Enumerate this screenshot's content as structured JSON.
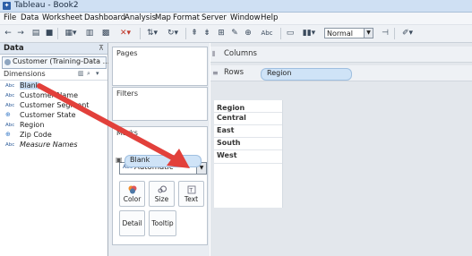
{
  "window": {
    "title": "Tableau - Book2"
  },
  "menu": [
    "File",
    "Data",
    "Worksheet",
    "Dashboard",
    "Analysis",
    "Map",
    "Format",
    "Server",
    "Window",
    "Help"
  ],
  "toolbar": {
    "fit_value": "Normal"
  },
  "data_panel": {
    "title": "Data",
    "datasource": "Customer (Training-Data ....",
    "dimensions_label": "Dimensions",
    "fields": [
      {
        "type": "Abc",
        "name": "Blank"
      },
      {
        "type": "Abc",
        "name": "Customer Name"
      },
      {
        "type": "Abc",
        "name": "Customer Segment"
      },
      {
        "type": "globe",
        "name": "Customer State"
      },
      {
        "type": "Abc",
        "name": "Region"
      },
      {
        "type": "globe",
        "name": "Zip Code"
      },
      {
        "type": "Abc",
        "name": "Measure Names"
      }
    ]
  },
  "shelves": {
    "pages_label": "Pages",
    "filters_label": "Filters",
    "marks_label": "Marks",
    "mark_type": "Automatic",
    "mark_type_icon": "Abc",
    "buttons": {
      "color": "Color",
      "size": "Size",
      "text": "Text",
      "detail": "Detail",
      "tooltip": "Tooltip"
    },
    "text_pill": "Blank"
  },
  "view": {
    "columns_label": "Columns",
    "rows_label": "Rows",
    "rows_pill": "Region",
    "table_header": "Region",
    "regions": [
      "Central",
      "East",
      "South",
      "West"
    ]
  },
  "colors": {
    "arrow": "#e2403b",
    "pill": "#cfe3f7",
    "panel": "#e9edf2"
  }
}
